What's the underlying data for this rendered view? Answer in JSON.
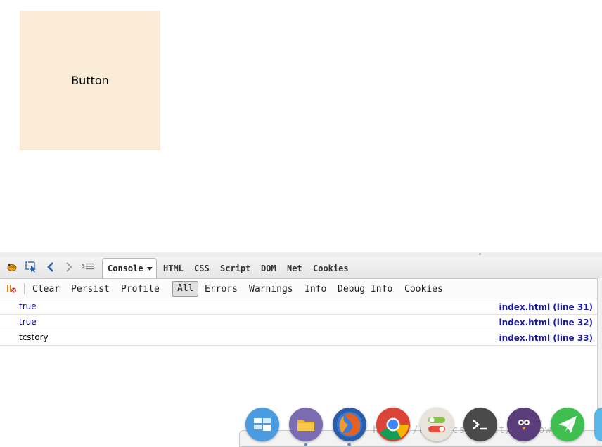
{
  "page": {
    "button_label": "Button"
  },
  "firebug": {
    "tabs": [
      "Console",
      "HTML",
      "CSS",
      "Script",
      "DOM",
      "Net",
      "Cookies"
    ],
    "console_toolbar": {
      "clear": "Clear",
      "persist": "Persist",
      "profile": "Profile",
      "filters": [
        "All",
        "Errors",
        "Warnings",
        "Info",
        "Debug Info",
        "Cookies"
      ],
      "selected_filter": "All"
    },
    "log": [
      {
        "message": "true",
        "source": "index.html (line 31)"
      },
      {
        "message": "true",
        "source": "index.html (line 32)"
      },
      {
        "message": "tcstory",
        "source": "index.html (line 33)"
      }
    ]
  },
  "dock": {
    "apps": [
      "multitasking-view-icon",
      "file-manager-icon",
      "firefox-icon",
      "chrome-icon",
      "settings-toggle-icon",
      "terminal-icon",
      "bird-app-icon",
      "send-app-icon"
    ]
  },
  "watermark": "http://blog.csdn.net/shadow_zed"
}
